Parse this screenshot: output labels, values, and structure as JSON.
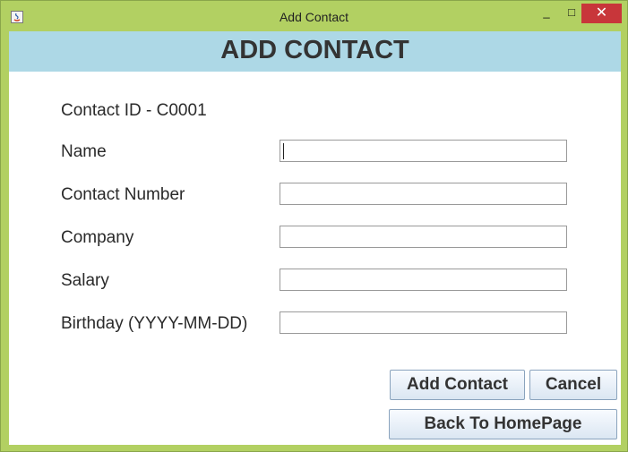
{
  "window": {
    "title": "Add Contact",
    "controls": {
      "minimize": "_",
      "maximize": "□",
      "close": "✕"
    }
  },
  "header": {
    "title": "ADD CONTACT"
  },
  "form": {
    "contact_id": "Contact ID - C0001",
    "fields": [
      {
        "label": "Name",
        "value": ""
      },
      {
        "label": "Contact Number",
        "value": ""
      },
      {
        "label": "Company",
        "value": ""
      },
      {
        "label": "Salary",
        "value": ""
      },
      {
        "label": "Birthday (YYYY-MM-DD)",
        "value": ""
      }
    ]
  },
  "buttons": {
    "add": "Add Contact",
    "cancel": "Cancel",
    "back": "Back To HomePage"
  },
  "colors": {
    "window_frame": "#b2d062",
    "header_bg": "#add8e6",
    "close_button": "#c8363a"
  }
}
